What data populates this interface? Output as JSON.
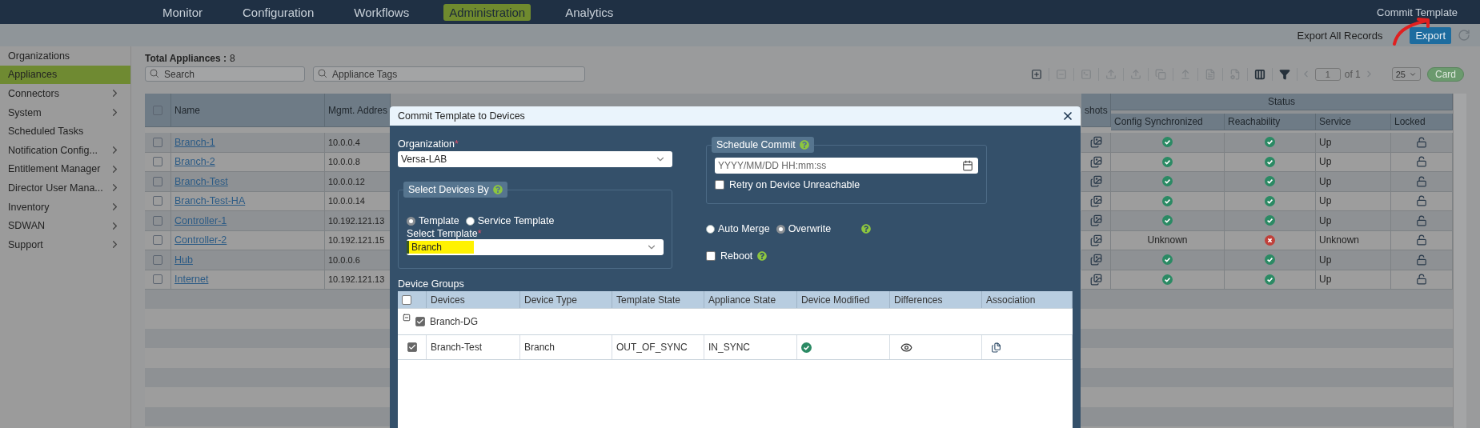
{
  "top_nav": {
    "items": [
      {
        "label": "Monitor",
        "selected": false
      },
      {
        "label": "Configuration",
        "selected": false
      },
      {
        "label": "Workflows",
        "selected": false
      },
      {
        "label": "Administration",
        "selected": true
      },
      {
        "label": "Analytics",
        "selected": false
      }
    ],
    "commit_template": "Commit Template"
  },
  "sub_bar": {
    "export_all": "Export All Records",
    "export_button": "Export"
  },
  "sidebar": {
    "items": [
      {
        "label": "Organizations",
        "selected": false,
        "expandable": false
      },
      {
        "label": "Appliances",
        "selected": true,
        "expandable": false
      },
      {
        "label": "Connectors",
        "selected": false,
        "expandable": true
      },
      {
        "label": "System",
        "selected": false,
        "expandable": true
      },
      {
        "label": "Scheduled Tasks",
        "selected": false,
        "expandable": false
      },
      {
        "label": "Notification Config...",
        "selected": false,
        "expandable": true
      },
      {
        "label": "Entitlement Manager",
        "selected": false,
        "expandable": true
      },
      {
        "label": "Director User Mana...",
        "selected": false,
        "expandable": true
      },
      {
        "label": "Inventory",
        "selected": false,
        "expandable": true
      },
      {
        "label": "SDWAN",
        "selected": false,
        "expandable": true
      },
      {
        "label": "Support",
        "selected": false,
        "expandable": true
      }
    ]
  },
  "appliances": {
    "total_label": "Total Appliances :",
    "total": "8",
    "search": {
      "placeholder": "Search"
    },
    "tags": {
      "placeholder": "Appliance Tags"
    },
    "toolbar": [
      {
        "kind": "add",
        "disabled": false
      },
      {
        "kind": "remove",
        "disabled": true
      },
      {
        "kind": "terminal",
        "disabled": true
      },
      {
        "kind": "deploy",
        "disabled": true
      },
      {
        "kind": "deploy",
        "disabled": true
      },
      {
        "kind": "clone",
        "disabled": true
      },
      {
        "kind": "upload",
        "disabled": true
      },
      {
        "kind": "document",
        "disabled": true
      },
      {
        "kind": "document-settings",
        "disabled": true
      },
      {
        "kind": "columns",
        "disabled": false
      },
      {
        "kind": "filter",
        "disabled": false
      }
    ],
    "pagination": {
      "page": "1",
      "of": "of 1",
      "page_size": "25",
      "card_button": "Card"
    },
    "table": {
      "all_selected": false,
      "columns": [
        "Name",
        "Mgmt. Addres",
        "shots"
      ],
      "status_group": "Status",
      "status_columns": [
        "Config Synchronized",
        "Reachability",
        "Service",
        "Locked"
      ],
      "rows": [
        {
          "selected": false,
          "name": "Branch-1",
          "mgmt": "10.0.0.4",
          "config": {
            "kind": "icon",
            "ok": true
          },
          "reachable": true,
          "service": "Up",
          "locked": false
        },
        {
          "selected": false,
          "name": "Branch-2",
          "mgmt": "10.0.0.8",
          "config": {
            "kind": "icon",
            "ok": true
          },
          "reachable": true,
          "service": "Up",
          "locked": false
        },
        {
          "selected": false,
          "name": "Branch-Test",
          "mgmt": "10.0.0.12",
          "config": {
            "kind": "icon",
            "ok": true
          },
          "reachable": true,
          "service": "Up",
          "locked": false
        },
        {
          "selected": false,
          "name": "Branch-Test-HA",
          "mgmt": "10.0.0.14",
          "config": {
            "kind": "icon",
            "ok": true
          },
          "reachable": true,
          "service": "Up",
          "locked": false
        },
        {
          "selected": false,
          "name": "Controller-1",
          "mgmt": "10.192.121.13",
          "config": {
            "kind": "icon",
            "ok": true
          },
          "reachable": true,
          "service": "Up",
          "locked": false
        },
        {
          "selected": false,
          "name": "Controller-2",
          "mgmt": "10.192.121.15",
          "config": {
            "kind": "text",
            "text": "Unknown"
          },
          "reachable": false,
          "service": "Unknown",
          "locked": false
        },
        {
          "selected": false,
          "name": "Hub",
          "mgmt": "10.0.0.6",
          "config": {
            "kind": "icon",
            "ok": true
          },
          "reachable": true,
          "service": "Up",
          "locked": false
        },
        {
          "selected": false,
          "name": "Internet",
          "mgmt": "10.192.121.13",
          "config": {
            "kind": "icon",
            "ok": true
          },
          "reachable": true,
          "service": "Up",
          "locked": false
        }
      ]
    }
  },
  "dialog": {
    "title": "Commit Template to Devices",
    "organization": {
      "label": "Organization",
      "required_mark": "*",
      "value": "Versa-LAB"
    },
    "select_devices_by": {
      "legend": "Select Devices By",
      "options": [
        {
          "label": "Template",
          "selected": true
        },
        {
          "label": "Service Template",
          "selected": false
        }
      ],
      "template": {
        "label": "Select Template",
        "required_mark": "*",
        "value": "Branch"
      }
    },
    "schedule_commit": {
      "legend": "Schedule Commit",
      "placeholder": "YYYY/MM/DD HH:mm:ss",
      "retry": {
        "label": "Retry on Device Unreachable",
        "checked": false
      }
    },
    "merge_options": [
      {
        "label": "Auto Merge",
        "selected": false
      },
      {
        "label": "Overwrite",
        "selected": true
      }
    ],
    "reboot": {
      "label": "Reboot",
      "checked": false
    },
    "device_groups": {
      "label": "Device Groups",
      "all_checked": false,
      "columns": [
        "Devices",
        "Device Type",
        "Template State",
        "Appliance State",
        "Device Modified",
        "Differences",
        "Association"
      ],
      "groups": [
        {
          "name": "Branch-DG",
          "checked": true,
          "expanded": true,
          "children": [
            {
              "device": "Branch-Test",
              "type": "Branch",
              "template_state": "OUT_OF_SYNC",
              "appliance_state": "IN_SYNC",
              "checked": true,
              "modified": true
            }
          ]
        }
      ]
    }
  }
}
